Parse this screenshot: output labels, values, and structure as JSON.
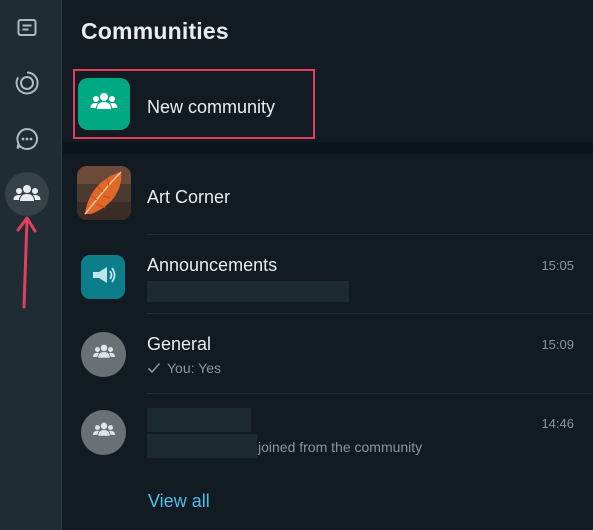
{
  "rail": {
    "items": [
      {
        "icon": "chats-icon"
      },
      {
        "icon": "status-icon"
      },
      {
        "icon": "channels-icon"
      },
      {
        "icon": "communities-icon",
        "active": true
      }
    ],
    "arrow_color": "#e0405f"
  },
  "panel": {
    "title": "Communities",
    "new_community": {
      "label": "New community",
      "highlight_color": "#e0405f",
      "avatar_color": "#00a884"
    },
    "communities": [
      {
        "name": "Art Corner"
      }
    ],
    "chats": [
      {
        "name": "Announcements",
        "time": "15:05",
        "preview": ""
      },
      {
        "name": "General",
        "time": "15:09",
        "preview": "You: Yes"
      },
      {
        "name": "",
        "time": "14:46",
        "preview": "joined from the community"
      }
    ],
    "view_all": "View all"
  },
  "colors": {
    "background": "#111b21",
    "rail": "#202c33",
    "accent": "#00a884",
    "link": "#53bdeb",
    "secondary_text": "#8696a0"
  }
}
